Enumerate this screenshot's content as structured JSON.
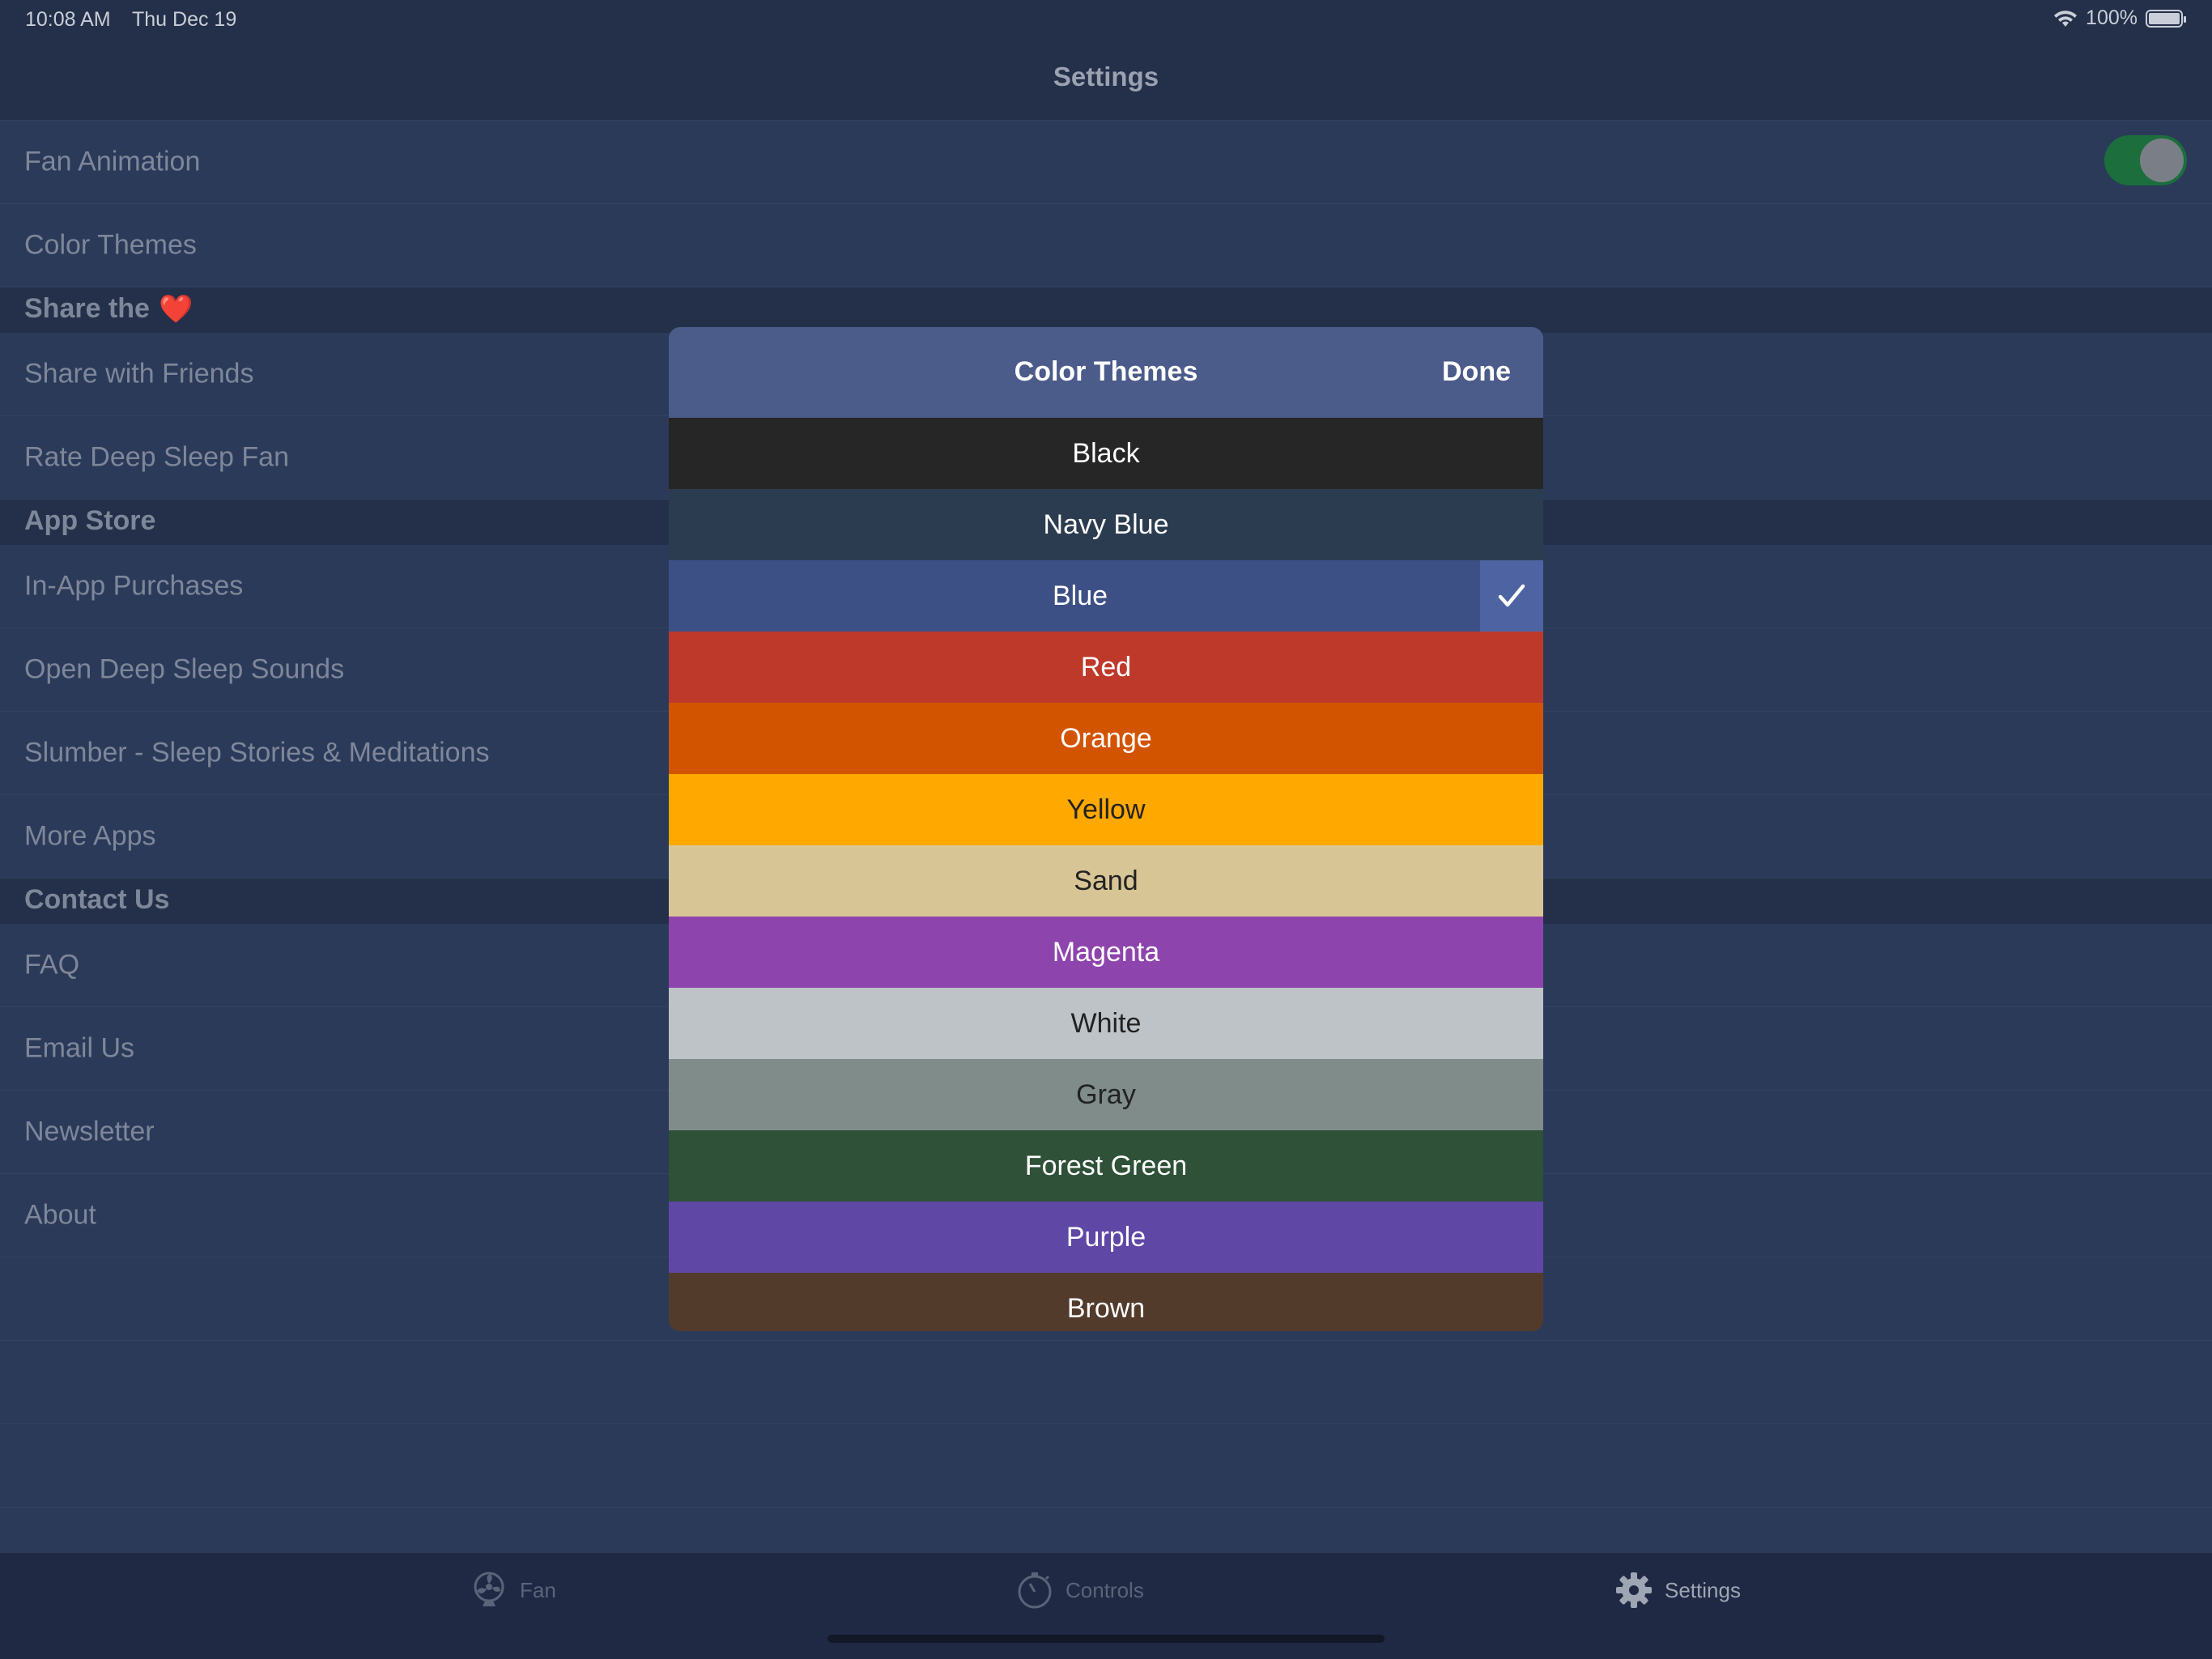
{
  "status_bar": {
    "time": "10:08 AM",
    "date": "Thu Dec 19",
    "battery": "100%"
  },
  "nav": {
    "title": "Settings"
  },
  "settings": {
    "rows": [
      {
        "type": "row",
        "name": "fan-animation-row",
        "label": "Fan Animation",
        "toggle": true
      },
      {
        "type": "row",
        "name": "color-themes-row",
        "label": "Color Themes"
      },
      {
        "type": "section",
        "name": "section-share",
        "label": "Share the",
        "emoji": "❤️"
      },
      {
        "type": "row",
        "name": "share-with-friends-row",
        "label": "Share with Friends"
      },
      {
        "type": "row",
        "name": "rate-app-row",
        "label": "Rate Deep Sleep Fan"
      },
      {
        "type": "section",
        "name": "section-app-store",
        "label": "App Store"
      },
      {
        "type": "row",
        "name": "in-app-purchases-row",
        "label": "In-App Purchases"
      },
      {
        "type": "row",
        "name": "open-deep-sleep-sounds-row",
        "label": "Open Deep Sleep Sounds"
      },
      {
        "type": "row",
        "name": "slumber-row",
        "label": "Slumber - Sleep Stories & Meditations"
      },
      {
        "type": "row",
        "name": "more-apps-row",
        "label": "More Apps"
      },
      {
        "type": "section",
        "name": "section-contact-us",
        "label": "Contact Us"
      },
      {
        "type": "row",
        "name": "faq-row",
        "label": "FAQ"
      },
      {
        "type": "row",
        "name": "email-us-row",
        "label": "Email Us"
      },
      {
        "type": "row",
        "name": "newsletter-row",
        "label": "Newsletter"
      },
      {
        "type": "row",
        "name": "about-row",
        "label": "About"
      },
      {
        "type": "row",
        "name": "empty-row",
        "label": ""
      },
      {
        "type": "row",
        "name": "empty-row",
        "label": ""
      },
      {
        "type": "row",
        "name": "empty-row",
        "label": ""
      }
    ]
  },
  "modal": {
    "title": "Color Themes",
    "done_label": "Done",
    "selected": "Blue",
    "themes": [
      {
        "label": "Black",
        "bg": "#262626",
        "fg": "#ffffff"
      },
      {
        "label": "Navy Blue",
        "bg": "#2c3c50",
        "fg": "#ffffff"
      },
      {
        "label": "Blue",
        "bg": "#3d5085",
        "fg": "#ffffff"
      },
      {
        "label": "Red",
        "bg": "#bf392b",
        "fg": "#ffffff"
      },
      {
        "label": "Orange",
        "bg": "#d35400",
        "fg": "#ffffff"
      },
      {
        "label": "Yellow",
        "bg": "#ffa800",
        "fg": "#222222"
      },
      {
        "label": "Sand",
        "bg": "#d8c596",
        "fg": "#222222"
      },
      {
        "label": "Magenta",
        "bg": "#8e44ad",
        "fg": "#ffffff"
      },
      {
        "label": "White",
        "bg": "#bdc3c7",
        "fg": "#222222"
      },
      {
        "label": "Gray",
        "bg": "#7f8c8a",
        "fg": "#222222"
      },
      {
        "label": "Forest Green",
        "bg": "#2e5137",
        "fg": "#ffffff"
      },
      {
        "label": "Purple",
        "bg": "#5e47a5",
        "fg": "#ffffff"
      },
      {
        "label": "Brown",
        "bg": "#533b2c",
        "fg": "#ffffff"
      }
    ]
  },
  "tabs": [
    {
      "name": "tab-fan",
      "label": "Fan",
      "icon": "fan-icon",
      "active": false
    },
    {
      "name": "tab-controls",
      "label": "Controls",
      "icon": "timer-icon",
      "active": false
    },
    {
      "name": "tab-settings",
      "label": "Settings",
      "icon": "gear-icon",
      "active": true
    }
  ],
  "colors": {
    "background": "#2c3a5a",
    "header": "#243049",
    "modal_header": "#4b5b8a",
    "toggle_on": "#1c6e3c"
  }
}
